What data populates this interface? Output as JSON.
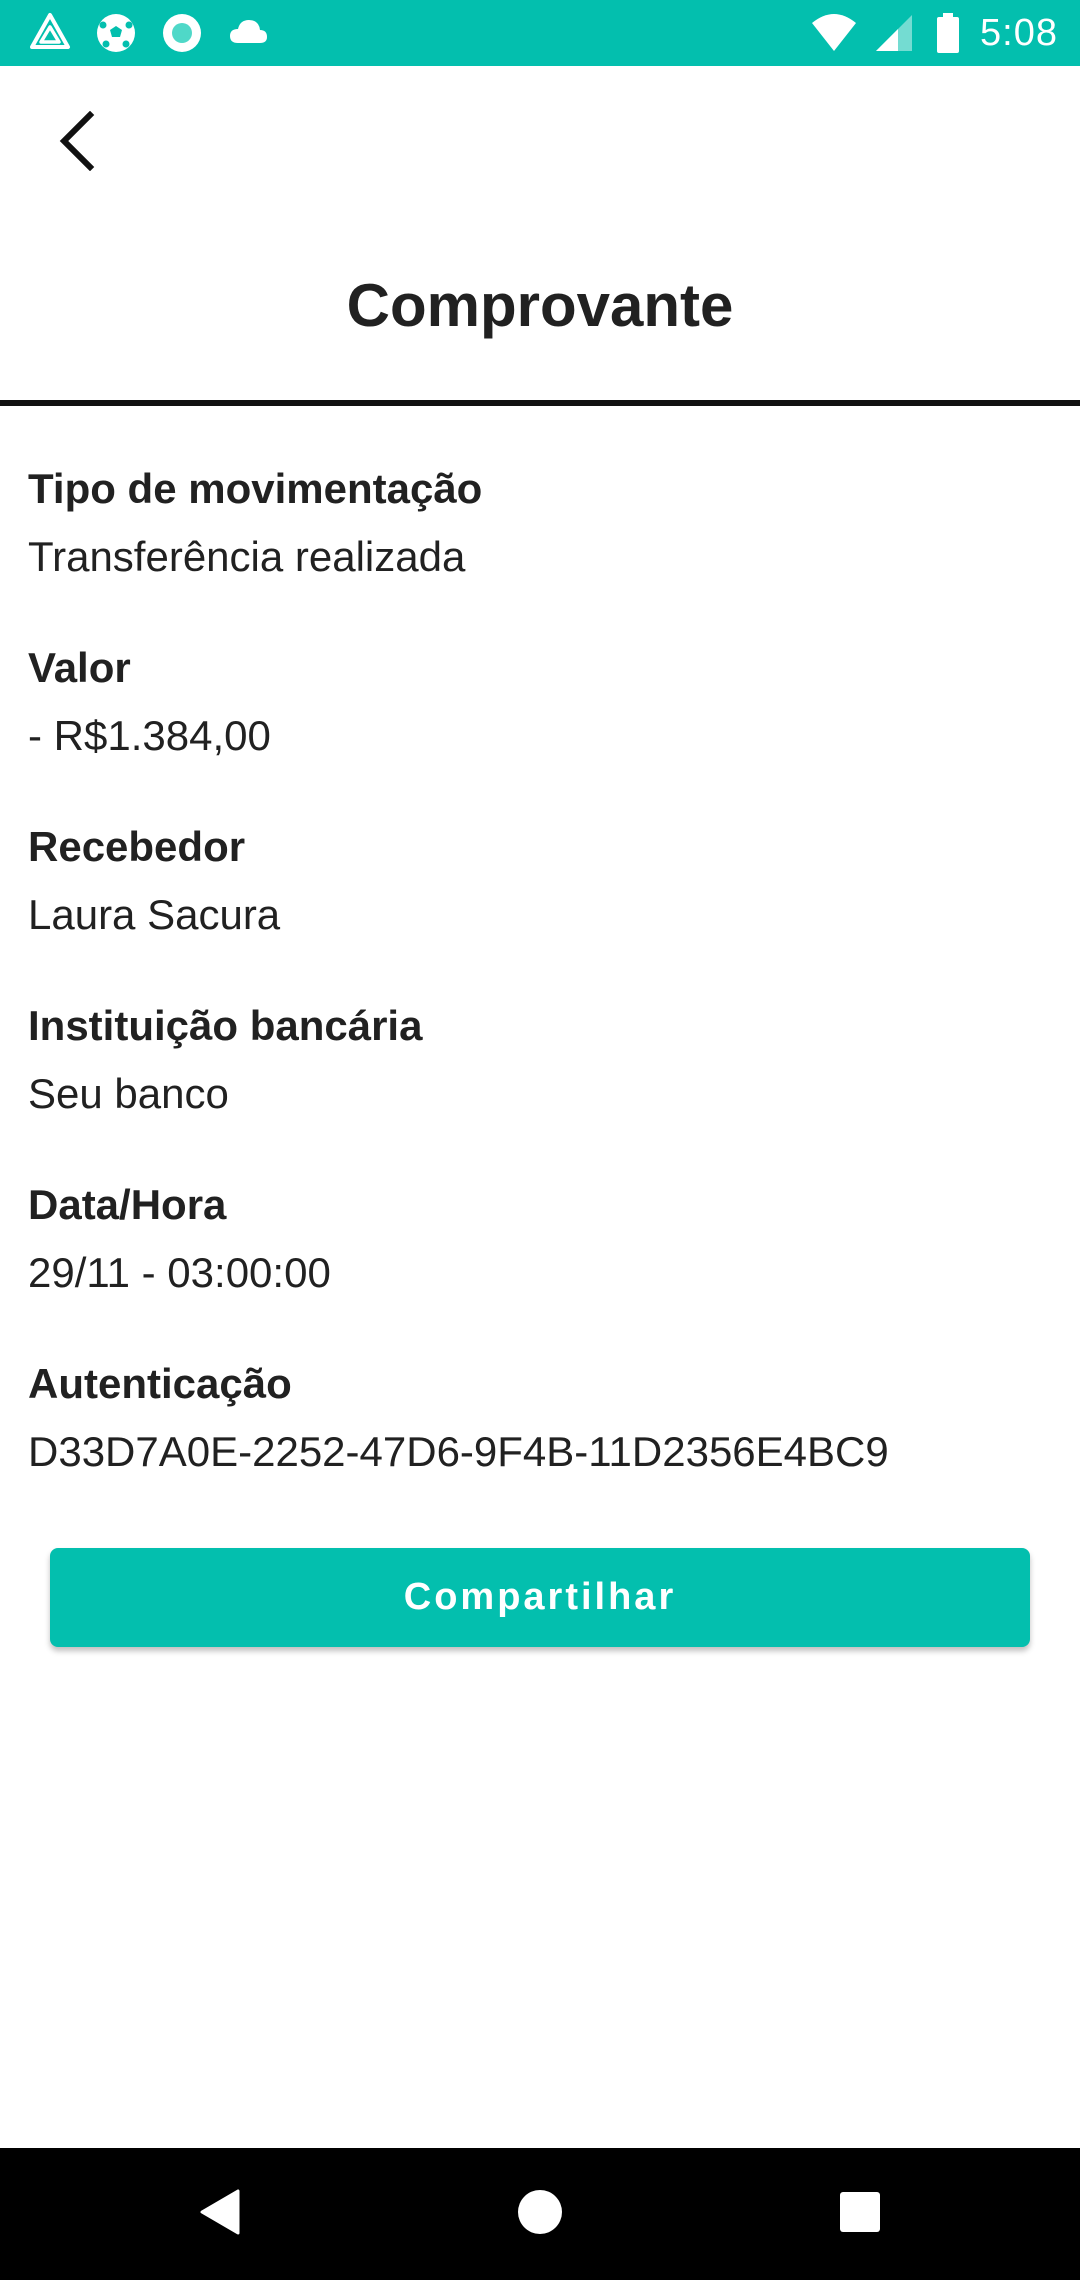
{
  "status_bar": {
    "time": "5:08",
    "left_icons": [
      "triangle-logo-icon",
      "soccer-ball-icon",
      "circle-app-icon",
      "cloud-icon"
    ],
    "right_icons": [
      "wifi-icon",
      "cellular-signal-icon",
      "battery-icon"
    ],
    "background_color": "#03bfae"
  },
  "header": {
    "back_icon": "chevron-left-icon",
    "title": "Comprovante"
  },
  "details": [
    {
      "label": "Tipo de movimentação",
      "value": "Transferência realizada"
    },
    {
      "label": "Valor",
      "value": "- R$1.384,00"
    },
    {
      "label": "Recebedor",
      "value": "Laura Sacura"
    },
    {
      "label": "Instituição bancária",
      "value": "Seu banco"
    },
    {
      "label": "Data/Hora",
      "value": "29/11 - 03:00:00"
    },
    {
      "label": "Autenticação",
      "value": "D33D7A0E-2252-47D6-9F4B-11D2356E4BC9"
    }
  ],
  "share_button": {
    "label": "Compartilhar",
    "color": "#03bfae"
  },
  "nav_bar": {
    "icons": [
      "back-triangle-icon",
      "home-circle-icon",
      "recents-square-icon"
    ]
  }
}
